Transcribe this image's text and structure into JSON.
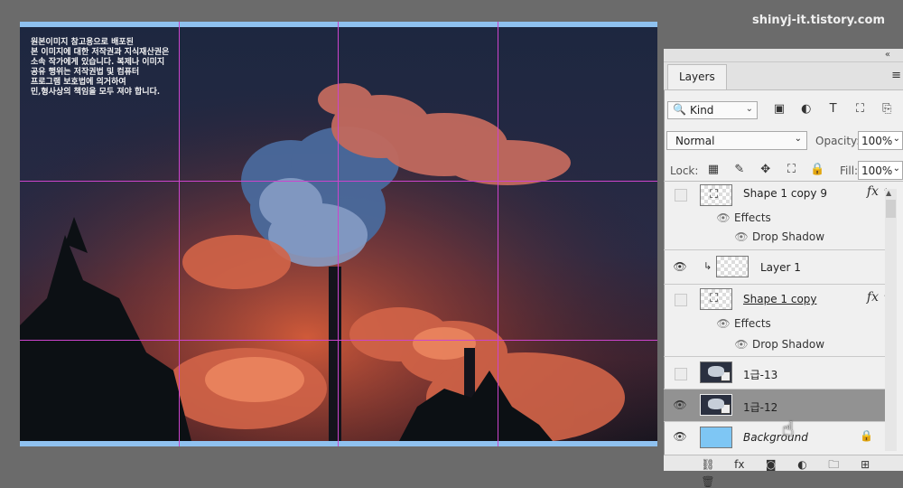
{
  "watermark": "shinyj-it.tistory.com",
  "canvas": {
    "notice_lines": [
      "원본이미지 참고용으로 배포된",
      "본 이미지에 대한 저작권과 지식재산권은",
      "소속 작가에게 있습니다. 복제나 이미지",
      "공유 행위는 저작권법 및 컴퓨터",
      "프로그램 보호법에 의거하여",
      "민,형사상의 책임을 모두 져야 합니다."
    ]
  },
  "panel": {
    "tab_label": "Layers",
    "collapse_icon": "«",
    "menu_icon": "≡",
    "filter": {
      "kind_label": "Kind",
      "search_icon": "🔍",
      "chevron": "⌄"
    },
    "filter_icons": [
      "▣",
      "◐",
      "T",
      "⛶",
      "⎘"
    ],
    "blend_mode": "Normal",
    "opacity_label": "Opacity:",
    "opacity_value": "100%",
    "lock_label": "Lock:",
    "lock_icons": [
      "▦",
      "✎",
      "✥",
      "⛶",
      "🔒"
    ],
    "fill_label": "Fill:",
    "fill_value": "100%",
    "layers": [
      {
        "name": "Shape 1 copy 9",
        "visible": false,
        "fx": "fx",
        "effects_label": "Effects",
        "effect_item": "Drop Shadow"
      },
      {
        "name": "Layer 1",
        "visible": true,
        "clipped": true
      },
      {
        "name": "Shape 1 copy",
        "visible": false,
        "fx": "fx",
        "effects_label": "Effects",
        "effect_item": "Drop Shadow"
      },
      {
        "name": "1급-13",
        "visible": false
      },
      {
        "name": "1급-12",
        "visible": true,
        "selected": true
      },
      {
        "name": "Background",
        "visible": true,
        "locked": true
      }
    ],
    "footer_icons": [
      "⛓",
      "fx",
      "◙",
      "◐",
      "🗀",
      "⊞",
      "🗑"
    ]
  },
  "colors": {
    "app_background": "#6b6b6b",
    "panel_background": "#f0f0f0",
    "selected_row": "#929292",
    "guide": "#cc44cc",
    "background_layer_thumb": "#7ec6f4"
  }
}
